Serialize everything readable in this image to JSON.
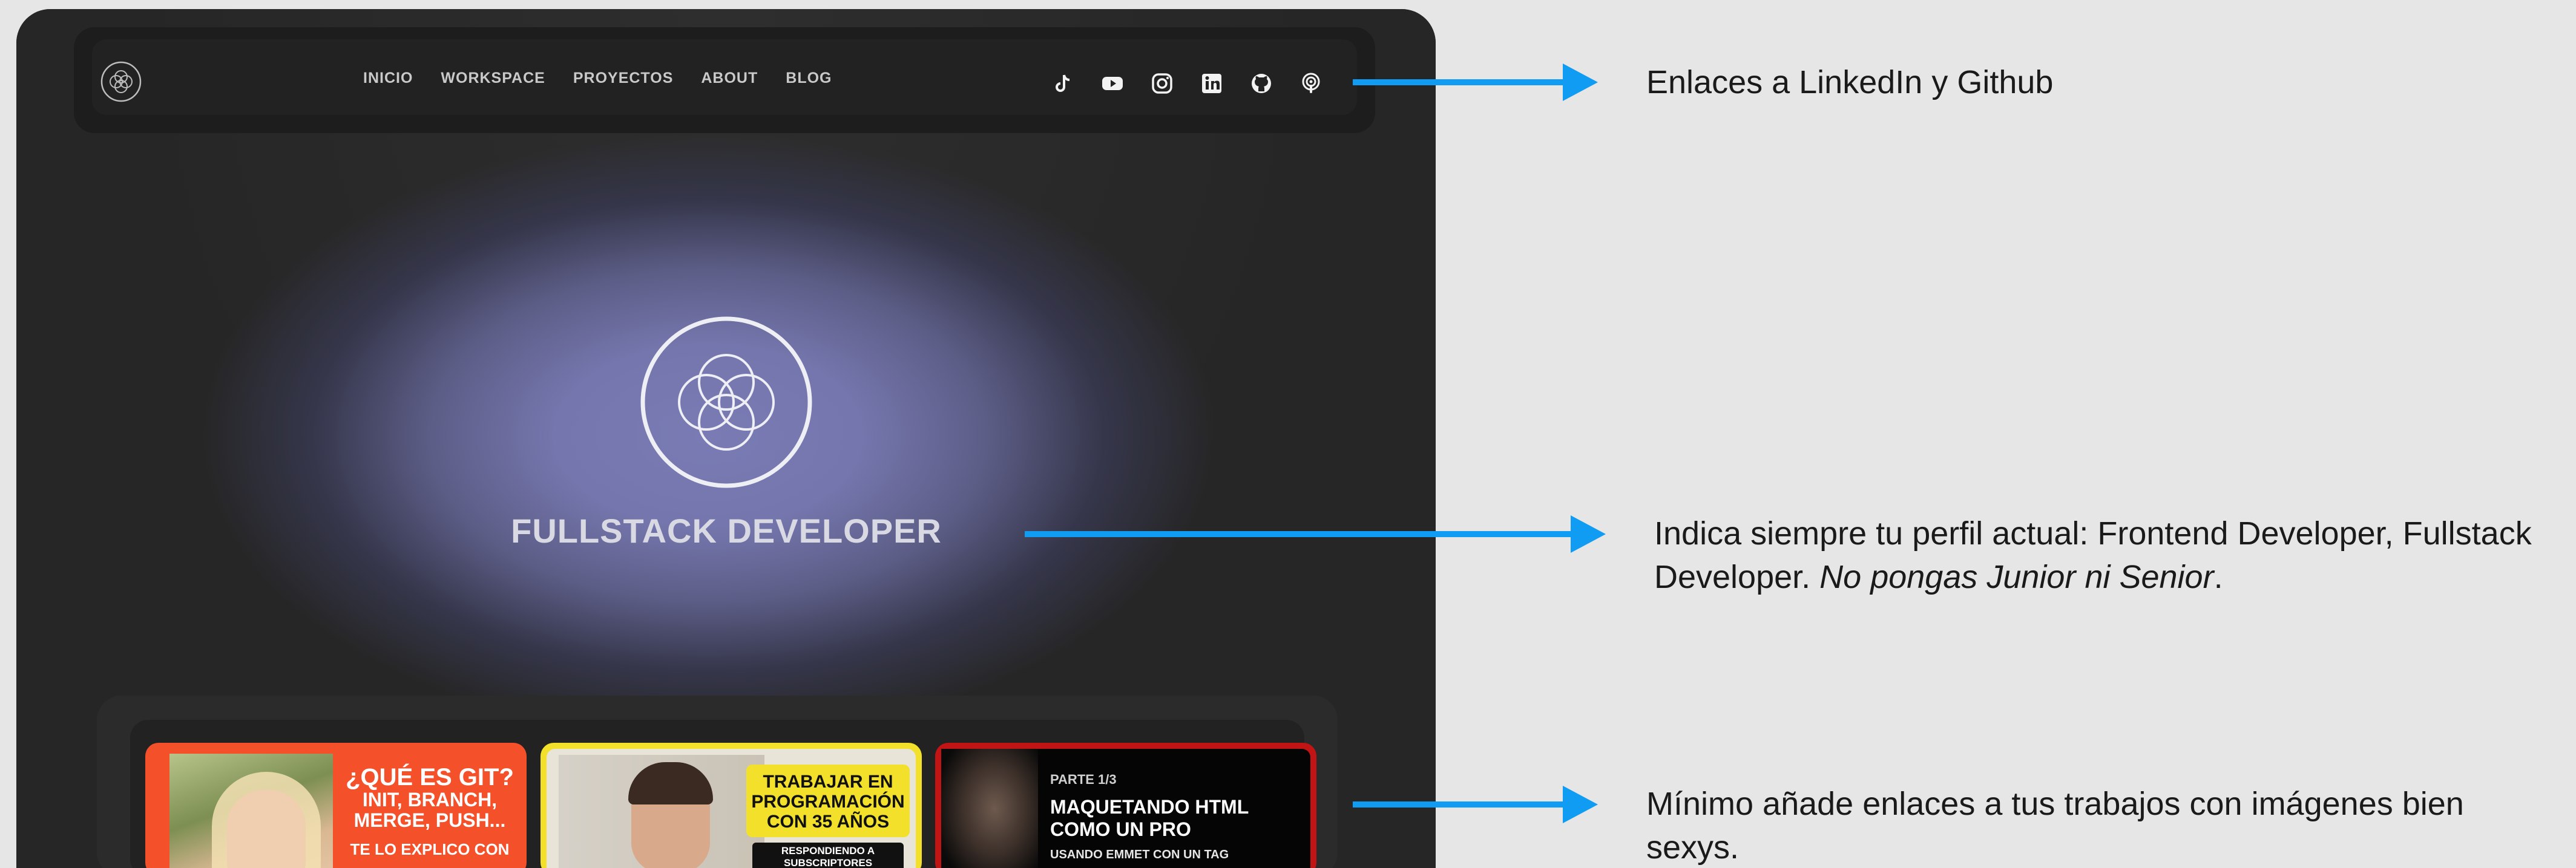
{
  "nav": {
    "links": [
      "INICIO",
      "WORKSPACE",
      "PROYECTOS",
      "ABOUT",
      "BLOG"
    ],
    "social_icons": [
      "tiktok-icon",
      "youtube-icon",
      "instagram-icon",
      "linkedin-icon",
      "github-icon",
      "podcast-icon"
    ]
  },
  "hero": {
    "title": "FULLSTACK DEVELOPER"
  },
  "projects": [
    {
      "line1": "¿QUÉ ES GIT?",
      "line2": "INIT, BRANCH,",
      "line3": "MERGE, PUSH...",
      "line4": "TE LO EXPLICO CON"
    },
    {
      "box": "TRABAJAR EN PROGRAMACIÓN CON 35 AÑOS",
      "badge": "RESPONDIENDO A SUBSCRIPTORES"
    },
    {
      "part": "PARTE 1/3",
      "title_line1": "MAQUETANDO HTML",
      "title_line2": "COMO UN PRO",
      "sub": "USANDO EMMET CON UN TAG"
    }
  ],
  "annotations": {
    "note1": "Enlaces a LinkedIn y Github",
    "note2_plain": "Indica siempre tu perfil actual: Frontend Developer, Fullstack Developer. ",
    "note2_italic": "No pongas Junior ni Senior",
    "note2_end": ".",
    "note3": "Mínimo añade enlaces a tus trabajos con imágenes bien sexys."
  },
  "colors": {
    "arrow": "#0f9cf2",
    "page_bg": "#e6e6e6",
    "site_bg": "#262626",
    "hero_glow": "#7a7bb4"
  }
}
